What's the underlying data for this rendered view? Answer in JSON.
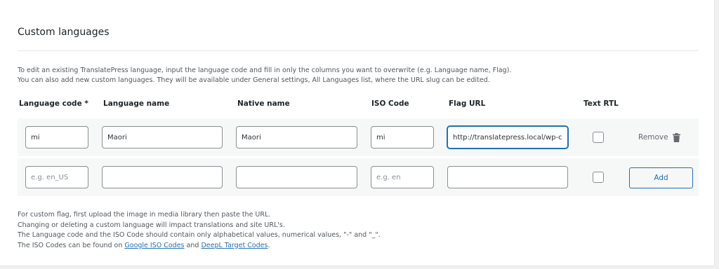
{
  "section": {
    "title": "Custom languages",
    "intro_line1": "To edit an existing TranslatePress language, input the language code and fill in only the columns you want to overwrite (e.g. Language name, Flag).",
    "intro_line2": "You can also add new custom languages. They will be available under General settings, All Languages list, where the URL slug can be edited."
  },
  "table": {
    "headers": {
      "language_code": "Language code *",
      "language_name": "Language name",
      "native_name": "Native name",
      "iso_code": "ISO Code",
      "flag_url": "Flag URL",
      "text_rtl": "Text RTL"
    },
    "existing_row": {
      "language_code": "mi",
      "language_name": "Maori",
      "native_name": "Maori",
      "iso_code": "mi",
      "flag_url": "http://translatepress.local/wp-content",
      "text_rtl": false,
      "remove_label": "Remove"
    },
    "new_row": {
      "language_code_placeholder": "e.g. en_US",
      "language_name": "",
      "native_name": "",
      "iso_code_placeholder": "e.g. en",
      "flag_url": "",
      "text_rtl": false,
      "add_label": "Add"
    }
  },
  "notes": {
    "line1": "For custom flag, first upload the image in media library then paste the URL.",
    "line2": "Changing or deleting a custom language will impact translations and site URL's.",
    "line3": "The Language code and the ISO Code should contain only alphabetical values, numerical values, \"-\" and \"_\".",
    "line4_prefix": "The ISO Codes can be found on ",
    "line4_link1": "Google ISO Codes",
    "line4_mid": " and ",
    "line4_link2": "DeepL Target Codes",
    "line4_suffix": "."
  },
  "colors": {
    "accent": "#2271b1",
    "page_bg": "#f0f0f1",
    "row_bg": "#f6f7f7"
  },
  "icons": {
    "remove": "trash-icon"
  }
}
